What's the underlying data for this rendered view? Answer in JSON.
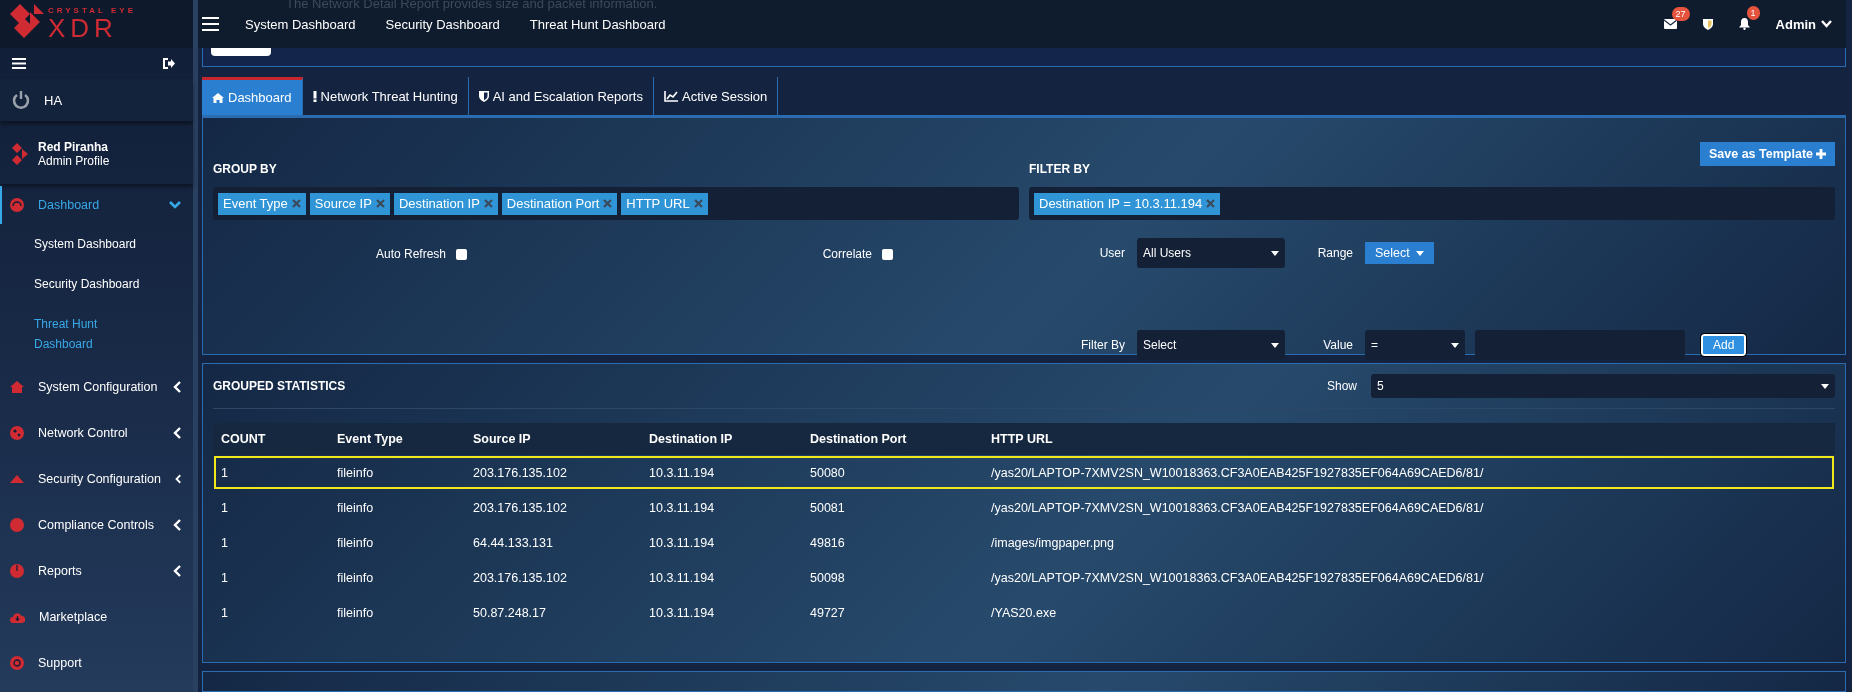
{
  "brand": {
    "tagline": "CRYSTAL EYE",
    "name": "XDR"
  },
  "top_nav": {
    "links": [
      {
        "label": "System Dashboard"
      },
      {
        "label": "Security Dashboard"
      },
      {
        "label": "Threat Hunt Dashboard"
      }
    ],
    "mail_badge": "27",
    "alert_badge": "1",
    "user": "Admin"
  },
  "header_card": {
    "description": "The Network Detail Report provides size and packet information."
  },
  "sidebar": {
    "ha_label": "HA",
    "profile": {
      "name": "Red Piranha",
      "role": "Admin Profile"
    },
    "items": [
      {
        "label": "Dashboard",
        "kind": "group",
        "selected": true,
        "expanded": true,
        "children": [
          {
            "label": "System Dashboard",
            "selected": false
          },
          {
            "label": "Security Dashboard",
            "selected": false
          },
          {
            "label": "Threat Hunt Dashboard",
            "selected": true
          }
        ]
      },
      {
        "label": "System Configuration",
        "kind": "group",
        "selected": false,
        "expanded": false
      },
      {
        "label": "Network Control",
        "kind": "group",
        "selected": false,
        "expanded": false
      },
      {
        "label": "Security Configuration",
        "kind": "group",
        "selected": false,
        "expanded": false
      },
      {
        "label": "Compliance Controls",
        "kind": "group",
        "selected": false,
        "expanded": false
      },
      {
        "label": "Reports",
        "kind": "group",
        "selected": false,
        "expanded": false
      },
      {
        "label": "Marketplace",
        "kind": "link",
        "selected": false
      },
      {
        "label": "Support",
        "kind": "link",
        "selected": false
      }
    ]
  },
  "tabs": [
    {
      "label": "Dashboard",
      "selected": true
    },
    {
      "label": "Network Threat Hunting",
      "selected": false
    },
    {
      "label": "AI and Escalation Reports",
      "selected": false
    },
    {
      "label": "Active Session",
      "selected": false
    }
  ],
  "save_template_button": "Save as Template",
  "group_by": {
    "title": "GROUP BY",
    "tags": [
      "Event Type",
      "Source IP",
      "Destination IP",
      "Destination Port",
      "HTTP URL"
    ]
  },
  "filter_by": {
    "title": "FILTER BY",
    "tags": [
      "Destination IP = 10.3.11.194"
    ]
  },
  "auto_refresh": {
    "label": "Auto Refresh",
    "checked": false
  },
  "correlate": {
    "label": "Correlate",
    "checked": false
  },
  "user_select": {
    "label": "User",
    "value": "All Users"
  },
  "range": {
    "label": "Range",
    "button": "Select"
  },
  "filter_select": {
    "label": "Filter By",
    "value": "Select"
  },
  "value_filter": {
    "label": "Value",
    "operator": "="
  },
  "add_button": "Add",
  "grouped_statistics": {
    "title": "GROUPED STATISTICS",
    "show_label": "Show",
    "show_value": "5",
    "columns": [
      "COUNT",
      "Event Type",
      "Source IP",
      "Destination IP",
      "Destination Port",
      "HTTP URL"
    ],
    "rows": [
      {
        "highlighted": true,
        "cells": [
          "1",
          "fileinfo",
          "203.176.135.102",
          "10.3.11.194",
          "50080",
          "/yas20/LAPTOP-7XMV2SN_W10018363.CF3A0EAB425F1927835EF064A69CAED6/81/"
        ]
      },
      {
        "highlighted": false,
        "cells": [
          "1",
          "fileinfo",
          "203.176.135.102",
          "10.3.11.194",
          "50081",
          "/yas20/LAPTOP-7XMV2SN_W10018363.CF3A0EAB425F1927835EF064A69CAED6/81/"
        ]
      },
      {
        "highlighted": false,
        "cells": [
          "1",
          "fileinfo",
          "64.44.133.131",
          "10.3.11.194",
          "49816",
          "/images/imgpaper.png"
        ]
      },
      {
        "highlighted": false,
        "cells": [
          "1",
          "fileinfo",
          "203.176.135.102",
          "10.3.11.194",
          "50098",
          "/yas20/LAPTOP-7XMV2SN_W10018363.CF3A0EAB425F1927835EF064A69CAED6/81/"
        ]
      },
      {
        "highlighted": false,
        "cells": [
          "1",
          "fileinfo",
          "50.87.248.17",
          "10.3.11.194",
          "49727",
          "/YAS20.exe"
        ]
      }
    ]
  }
}
